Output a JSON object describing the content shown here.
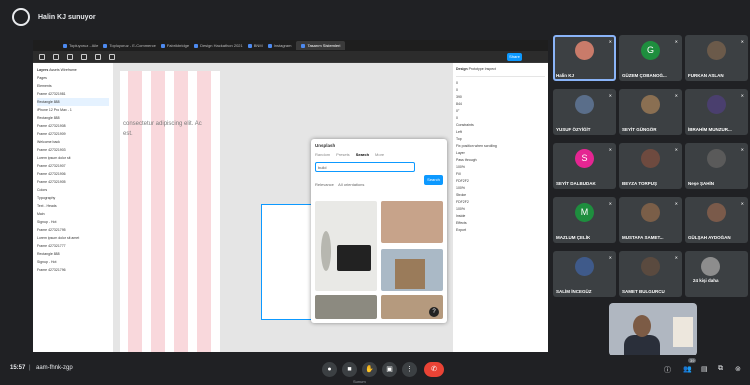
{
  "meeting": {
    "presenter_label": "Halin KJ sunuyor",
    "time": "15:57",
    "code": "aam-fhnk-zgp",
    "presentation_note": "Sunum"
  },
  "browser": {
    "tabs": [
      "Topluyoruz - Aile",
      "Topluyoruz - E-Commerce",
      "Fabrikbridge",
      "Design Hackathon 2021",
      "BNM",
      "Instagram",
      "Tasarım Sistemleri"
    ]
  },
  "figma": {
    "share_label": "Share",
    "layers_tabs": [
      "Layers",
      "Assets",
      "Wireframe"
    ],
    "pages_label": "Pages",
    "page_name": "Elements",
    "layers": [
      "Frame 427321981",
      "Rectangle 888",
      "iPhone 12 Pro Max - 1",
      "Rectangle 888",
      "Frame 427321908",
      "Frame 427321909",
      "Welcome back",
      "Frame 427321903",
      "Lorem ipsum dolor sit",
      "Frame 427321907",
      "Frame 427321906",
      "Frame 427321905",
      "Colors",
      "Typography",
      "Text - Heads",
      "Main",
      "Signup - Hot",
      "Frame 427321795",
      "Lorem ipsum dolor sit amet",
      "Frame 427321777",
      "Rectangle 888",
      "Signup - Hot",
      "Frame 427321796"
    ],
    "canvas_text_1": "consectetur adipiscing elit. Ac",
    "canvas_text_2": "est.",
    "modal": {
      "title": "Unsplash",
      "tabs": [
        "Random",
        "Presets",
        "Search",
        "More"
      ],
      "search_value": "build",
      "search_button": "Search",
      "filters": [
        "Relevance",
        "All orientations"
      ]
    },
    "props": {
      "tabs": [
        "Design",
        "Prototype",
        "Inspect"
      ],
      "rows": [
        "0",
        "0",
        "390",
        "844",
        "0°",
        "0",
        "Constraints",
        "Left",
        "Top",
        "Fix position when scrolling",
        "Layer",
        "Pass through",
        "100%",
        "Fill",
        "FDF2F2",
        "100%",
        "Stroke",
        "FDF2F2",
        "100%",
        "Inside",
        "Effects",
        "Export"
      ]
    }
  },
  "participants": [
    {
      "name": "Halin KJ",
      "type": "photo",
      "color": "#c97b6a",
      "speaking": true
    },
    {
      "name": "GÜZEM ÇOBANOĞ...",
      "type": "letter",
      "letter": "G",
      "color": "#1e8e3e"
    },
    {
      "name": "FURKAN ASLAN",
      "type": "photo",
      "color": "#6b5a4a"
    },
    {
      "name": "YUSUF ÖZYİĞİT",
      "type": "photo",
      "color": "#5a6e8a"
    },
    {
      "name": "SEYİT GÜNGÖR",
      "type": "photo",
      "color": "#8a6f52"
    },
    {
      "name": "İBRAHİM MUNZUR...",
      "type": "photo",
      "color": "#4a3f6e"
    },
    {
      "name": "SEYİT DALBUDAK",
      "type": "letter",
      "letter": "S",
      "color": "#e52592"
    },
    {
      "name": "BEYZA TORPUŞ",
      "type": "photo",
      "color": "#6e4a3f"
    },
    {
      "name": "Neşe ŞAHİN",
      "type": "photo",
      "color": "#5a5a5a"
    },
    {
      "name": "MAZLUM ÇELİK",
      "type": "letter",
      "letter": "M",
      "color": "#1e8e3e"
    },
    {
      "name": "MUSTAFA SAMET...",
      "type": "photo",
      "color": "#7a5e48"
    },
    {
      "name": "GÜLŞAH AYDOĞAN",
      "type": "photo",
      "color": "#7a5a4a"
    },
    {
      "name": "SALİM İNCEGÜZ",
      "type": "photo",
      "color": "#3f5a8a"
    },
    {
      "name": "SAMET BULGURCU",
      "type": "photo",
      "color": "#5a4a3f"
    },
    {
      "name": "24 kişi daha",
      "type": "more",
      "color": "#8d8d8d"
    }
  ],
  "controls": {
    "mic_icon": "mic-icon",
    "cam_icon": "camera-icon",
    "hand_icon": "hand-icon",
    "present_icon": "present-icon",
    "more_icon": "more-icon",
    "end_icon": "end-call-icon",
    "participant_count": "39"
  }
}
